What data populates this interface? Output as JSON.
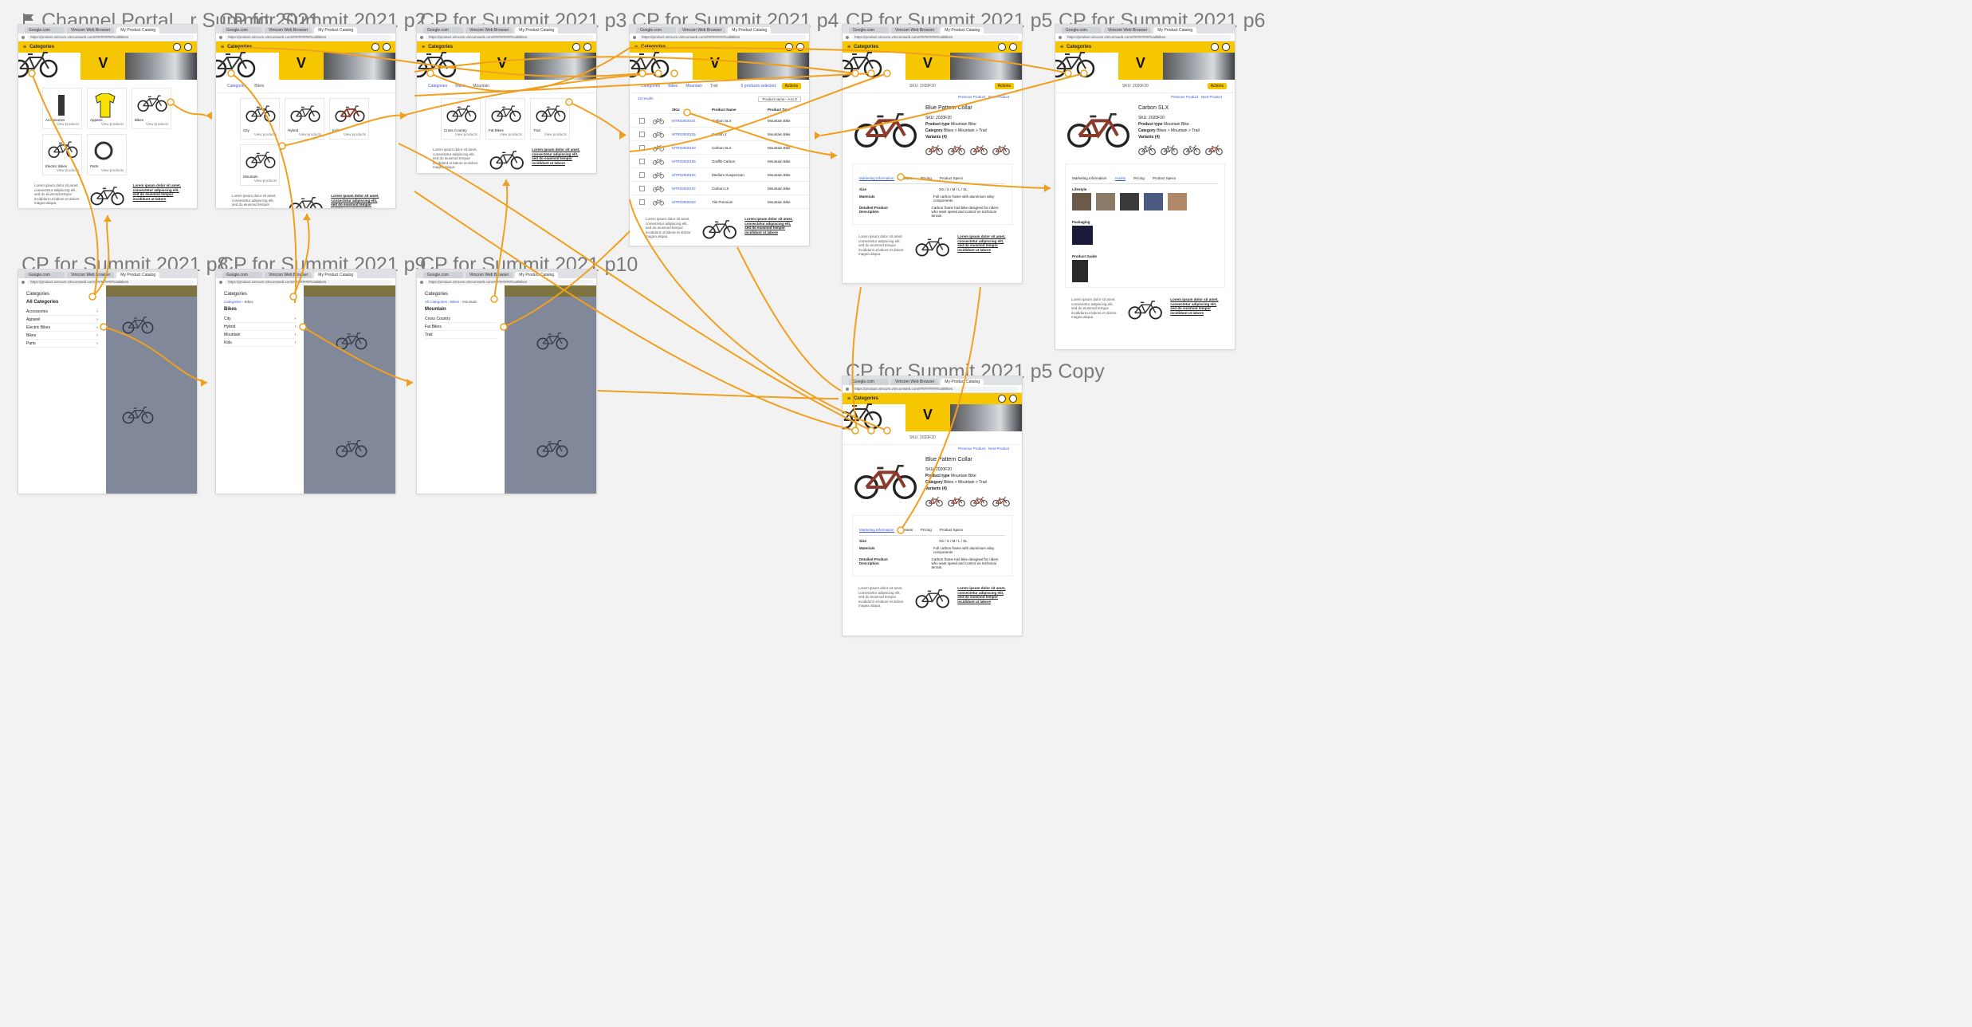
{
  "canvas": {
    "background": "#f2f2f2",
    "wire_color": "#f0a01e",
    "accent": "#f6c700"
  },
  "frames": [
    {
      "id": "f1",
      "label": "Channel Portal...r Summit 2021",
      "flag": true
    },
    {
      "id": "f2",
      "label": "CP for Summit 2021 p2"
    },
    {
      "id": "f3",
      "label": "CP for Summit 2021 p3"
    },
    {
      "id": "f4",
      "label": "CP for Summit 2021 p4"
    },
    {
      "id": "f5",
      "label": "CP for Summit 2021 p5"
    },
    {
      "id": "f6",
      "label": "CP for Summit 2021 p6"
    },
    {
      "id": "f8",
      "label": "CP for Summit 2021 p8"
    },
    {
      "id": "f9",
      "label": "CP for Summit 2021 p9"
    },
    {
      "id": "f10",
      "label": "CP for Summit 2021 p10"
    },
    {
      "id": "f5c",
      "label": "CP for Summit 2021 p5 Copy"
    }
  ],
  "browser": {
    "tabs": [
      "Google.com",
      "Vimcom Web Browser",
      "My Product Catalog"
    ],
    "url": "https://product.vimcom.vimcomweb.com/#/#/##/##/#/cat/Bikes"
  },
  "app": {
    "menu_label": "Categories",
    "logo": "V"
  },
  "p1": {
    "cards": [
      {
        "name": "Accessories",
        "link": "View products"
      },
      {
        "name": "Apparel",
        "link": "View products"
      },
      {
        "name": "Bikes",
        "link": "View products"
      },
      {
        "name": "Electric Bikes",
        "link": "View products"
      },
      {
        "name": "Parts",
        "link": "View products"
      }
    ]
  },
  "p2": {
    "crumb": [
      "Categories",
      "Bikes"
    ],
    "cards": [
      {
        "name": "City",
        "link": "View products"
      },
      {
        "name": "Hybrid",
        "link": "View products"
      },
      {
        "name": "Kids",
        "link": "View products"
      },
      {
        "name": "Mountain",
        "link": "View products"
      }
    ]
  },
  "p3": {
    "crumb": [
      "Categories",
      "Bikes",
      "Mountain"
    ],
    "cards": [
      {
        "name": "Cross Country",
        "link": "View products"
      },
      {
        "name": "Fat Bikes",
        "link": "View products"
      },
      {
        "name": "Trail",
        "link": "View products"
      }
    ]
  },
  "p4": {
    "crumb": [
      "Categories",
      "Bikes",
      "Mountain",
      "Trail"
    ],
    "selected": "0 products selected",
    "actions": "Actions",
    "results": "10 results",
    "sort": "Product name - A to Z",
    "columns": [
      "SKU",
      "Product Name",
      "Product Type"
    ],
    "rows": [
      {
        "sku": "MTR02930101",
        "name": "Carbon SLX",
        "type": "Mountain Bike"
      },
      {
        "sku": "MTR02930105",
        "name": "Carbon 2",
        "type": "Mountain Bike"
      },
      {
        "sku": "MTR02930103",
        "name": "Carbon SLX",
        "type": "Mountain Bike"
      },
      {
        "sku": "MTR02930106",
        "name": "Graffiti Carbon",
        "type": "Mountain Bike"
      },
      {
        "sku": "MTR02930102",
        "name": "Medium Suspension",
        "type": "Mountain Bike"
      },
      {
        "sku": "MTR02930107",
        "name": "Carbon LS",
        "type": "Mountain Bike"
      },
      {
        "sku": "MTR02930403",
        "name": "Tile Premium",
        "type": "Mountain Bike"
      }
    ]
  },
  "p5": {
    "crumb_last": "SKU: 2020F20",
    "nav": [
      "Previous Product",
      "Next Product"
    ],
    "actions": "Actions",
    "name": "Blue Pattern Collar",
    "sku": "SKU: 2020F20",
    "type_label": "Product type",
    "type": "Mountain Bike",
    "category_label": "Category",
    "category": "Bikes > Mountain > Trail",
    "variants_label": "Variants (4)",
    "tabs": [
      "Marketing Information",
      "Assets",
      "Pricing",
      "Product Specs"
    ],
    "specs": [
      {
        "k": "Size",
        "v": "XS / S / M / L / XL"
      },
      {
        "k": "Materials",
        "v": "Full carbon frame with aluminium alloy components"
      },
      {
        "k": "Detailed Product Description",
        "v": "Carbon frame trail bike designed for riders who want speed and control on technical terrain."
      }
    ]
  },
  "p6": {
    "name": "Carbon SLX",
    "sku": "SKU: 2020F20",
    "type": "Mountain Bike",
    "category": "Bikes > Mountain > Trail",
    "variants_label": "Variants (4)",
    "tabs": [
      "Marketing Information",
      "Assets",
      "Pricing",
      "Product Specs"
    ],
    "sections": [
      "Lifestyle",
      "Packaging",
      "Product Guide"
    ]
  },
  "p8": {
    "title": "Categories",
    "heading": "All Categories",
    "items": [
      "Accessories",
      "Apparel",
      "Electric Bikes",
      "Bikes",
      "Parts"
    ]
  },
  "p9": {
    "title": "Categories",
    "crumb": [
      "Categories",
      "Bikes"
    ],
    "heading": "Bikes",
    "items": [
      "City",
      "Hybrid",
      "Mountain",
      "Kids"
    ]
  },
  "p10": {
    "title": "Categories",
    "crumb": [
      "All Categories",
      "Bikes",
      "Mountain"
    ],
    "heading": "Mountain",
    "items": [
      "Cross Country",
      "Fat Bikes",
      "Trail"
    ]
  },
  "footer": {
    "left": "Lorem ipsum dolor sit amet, consectetur adipiscing elit, sed do eiusmod tempor incididunt ut labore et dolore magna aliqua.",
    "right": "Lorem ipsum dolor sit amet, consectetur adipiscing elit, sed do eiusmod tempor incididunt ut labore"
  }
}
